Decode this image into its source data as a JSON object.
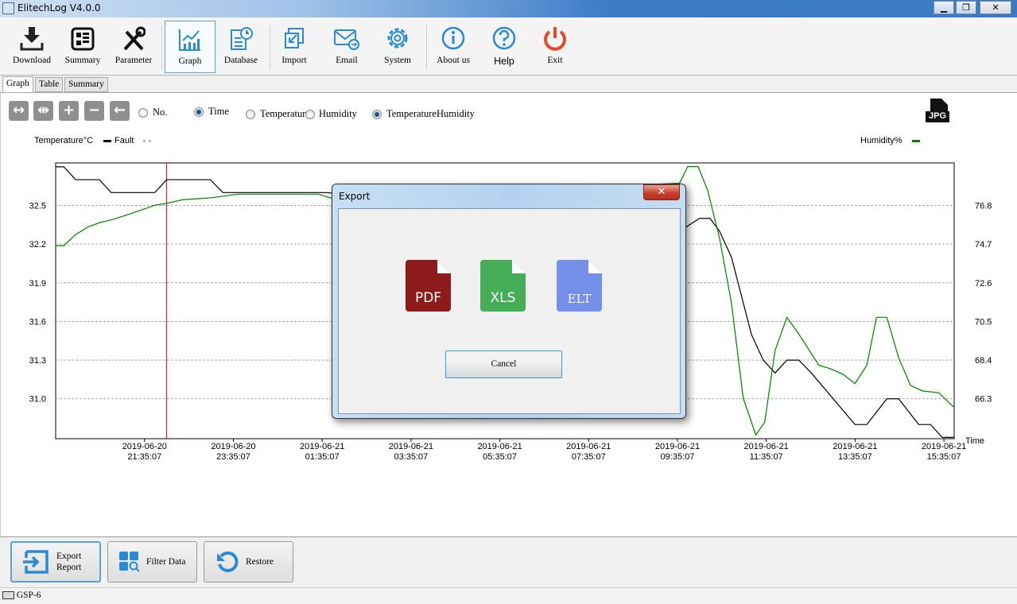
{
  "window": {
    "title": "ElitechLog V4.0.0",
    "minimize": "▁",
    "restore": "❐",
    "close": "✕"
  },
  "toolbar": {
    "items": [
      {
        "label": "Download",
        "icon": "download-icon"
      },
      {
        "label": "Summary",
        "icon": "summary-icon"
      },
      {
        "label": "Parameter",
        "icon": "tools-icon"
      },
      {
        "label": "Graph",
        "icon": "graph-icon",
        "selected": true
      },
      {
        "label": "Database",
        "icon": "database-icon"
      },
      {
        "label": "Import",
        "icon": "import-icon"
      },
      {
        "label": "Email",
        "icon": "email-icon"
      },
      {
        "label": "System",
        "icon": "gear-icon"
      },
      {
        "label": "About us",
        "icon": "info-icon"
      },
      {
        "label": "Help",
        "icon": "help-icon"
      },
      {
        "label": "Exit",
        "icon": "power-icon"
      }
    ]
  },
  "tabs": [
    {
      "label": "Graph",
      "active": true
    },
    {
      "label": "Table"
    },
    {
      "label": "Summary"
    }
  ],
  "graph_controls": {
    "buttons": [
      {
        "icon": "expand-icon",
        "glyph": "↔"
      },
      {
        "icon": "collapse-icon",
        "glyph": "⇹"
      },
      {
        "icon": "zoom-in-icon",
        "glyph": "+"
      },
      {
        "icon": "zoom-out-icon",
        "glyph": "−"
      },
      {
        "icon": "back-icon",
        "glyph": "←"
      }
    ],
    "axis_mode": [
      {
        "label": "No.",
        "selected": false
      },
      {
        "label": "Time",
        "selected": true
      }
    ],
    "series_mode": [
      {
        "label": "Temperatur",
        "selected": false
      },
      {
        "label": "Humidity",
        "selected": false
      },
      {
        "label": "TemperatureHumidity",
        "selected": true
      }
    ],
    "jpg_label": "JPG"
  },
  "legend": {
    "left_title": "Temperature°C",
    "fault_label": "Fault",
    "right_title": "Humidity%"
  },
  "colors": {
    "temperature": "#000000",
    "humidity": "#008000",
    "cursor": "#e00000",
    "accent": "#2a8ad4",
    "pdf": "#8e1b1b",
    "xls": "#46ad57",
    "elt": "#7490e8"
  },
  "chart_data": {
    "type": "line",
    "xlabel": "Time",
    "x_ticks": [
      "2019-06-20 21:35:07",
      "2019-06-20 23:35:07",
      "2019-06-21 01:35:07",
      "2019-06-21 03:35:07",
      "2019-06-21 05:35:07",
      "2019-06-21 07:35:07",
      "2019-06-21 09:35:07",
      "2019-06-21 11:35:07",
      "2019-06-21 13:35:07",
      "2019-06-21 15:35:07"
    ],
    "xlim": [
      "2019-06-20 19:35",
      "2019-06-21 15:49"
    ],
    "y_left": {
      "label": "Temperature°C",
      "ticks": [
        32.5,
        32.2,
        31.9,
        31.6,
        31.3,
        31.0
      ],
      "lim": [
        30.69,
        32.83
      ]
    },
    "y_right": {
      "label": "Humidity%",
      "ticks": [
        76.8,
        74.7,
        72.6,
        70.5,
        68.4,
        66.3
      ],
      "lim": [
        64.1,
        79.1
      ]
    },
    "grid": true,
    "cursor_time": "2019-06-20 22:05",
    "series": [
      {
        "name": "Temperature°C",
        "axis": "left",
        "points": [
          [
            "2019-06-20 19:35",
            32.8
          ],
          [
            "2019-06-20 19:46",
            32.8
          ],
          [
            "2019-06-20 20:02",
            32.7
          ],
          [
            "2019-06-20 20:34",
            32.7
          ],
          [
            "2019-06-20 20:50",
            32.6
          ],
          [
            "2019-06-20 21:49",
            32.6
          ],
          [
            "2019-06-20 22:05",
            32.7
          ],
          [
            "2019-06-20 23:04",
            32.7
          ],
          [
            "2019-06-20 23:21",
            32.6
          ],
          [
            "2019-06-21 01:40",
            32.6
          ],
          [
            "2019-06-21 05:00",
            32.5
          ],
          [
            "2019-06-21 09:38",
            32.3
          ],
          [
            "2019-06-21 10:05",
            32.4
          ],
          [
            "2019-06-21 10:19",
            32.4
          ],
          [
            "2019-06-21 10:32",
            32.3
          ],
          [
            "2019-06-21 10:48",
            32.1
          ],
          [
            "2019-06-21 11:15",
            31.5
          ],
          [
            "2019-06-21 11:31",
            31.3
          ],
          [
            "2019-06-21 11:47",
            31.2
          ],
          [
            "2019-06-21 12:03",
            31.3
          ],
          [
            "2019-06-21 12:19",
            31.3
          ],
          [
            "2019-06-21 12:36",
            31.2
          ],
          [
            "2019-06-21 13:35",
            30.8
          ],
          [
            "2019-06-21 13:51",
            30.8
          ],
          [
            "2019-06-21 14:18",
            31.0
          ],
          [
            "2019-06-21 14:34",
            31.0
          ],
          [
            "2019-06-21 15:01",
            30.8
          ],
          [
            "2019-06-21 15:17",
            30.8
          ],
          [
            "2019-06-21 15:33",
            30.7
          ],
          [
            "2019-06-21 15:49",
            30.7
          ]
        ]
      },
      {
        "name": "Humidity%",
        "axis": "right",
        "points": [
          [
            "2019-06-20 19:35",
            74.6
          ],
          [
            "2019-06-20 19:46",
            74.6
          ],
          [
            "2019-06-20 20:02",
            75.2
          ],
          [
            "2019-06-20 20:18",
            75.6
          ],
          [
            "2019-06-20 20:34",
            75.85
          ],
          [
            "2019-06-20 20:50",
            76.0
          ],
          [
            "2019-06-20 21:06",
            76.2
          ],
          [
            "2019-06-20 21:28",
            76.5
          ],
          [
            "2019-06-20 21:49",
            76.8
          ],
          [
            "2019-06-20 22:05",
            76.9
          ],
          [
            "2019-06-20 22:27",
            77.1
          ],
          [
            "2019-06-20 23:04",
            77.2
          ],
          [
            "2019-06-20 23:42",
            77.4
          ],
          [
            "2019-06-21 00:14",
            77.4
          ],
          [
            "2019-06-21 01:30",
            77.4
          ],
          [
            "2019-06-21 01:46",
            77.2
          ],
          [
            "2019-06-21 05:00",
            77.5
          ],
          [
            "2019-06-21 09:38",
            78.0
          ],
          [
            "2019-06-21 09:49",
            78.9
          ],
          [
            "2019-06-21 10:03",
            78.9
          ],
          [
            "2019-06-21 10:16",
            77.6
          ],
          [
            "2019-06-21 10:32",
            75.0
          ],
          [
            "2019-06-21 10:48",
            71.5
          ],
          [
            "2019-06-21 11:04",
            66.3
          ],
          [
            "2019-06-21 11:21",
            64.3
          ],
          [
            "2019-06-21 11:33",
            65.0
          ],
          [
            "2019-06-21 11:47",
            68.9
          ],
          [
            "2019-06-21 12:03",
            70.7
          ],
          [
            "2019-06-21 12:19",
            69.8
          ],
          [
            "2019-06-21 12:46",
            68.1
          ],
          [
            "2019-06-21 13:02",
            67.9
          ],
          [
            "2019-06-21 13:19",
            67.6
          ],
          [
            "2019-06-21 13:35",
            67.1
          ],
          [
            "2019-06-21 13:51",
            68.1
          ],
          [
            "2019-06-21 14:04",
            70.7
          ],
          [
            "2019-06-21 14:18",
            70.7
          ],
          [
            "2019-06-21 14:34",
            68.5
          ],
          [
            "2019-06-21 14:50",
            67.0
          ],
          [
            "2019-06-21 15:06",
            66.7
          ],
          [
            "2019-06-21 15:28",
            66.6
          ],
          [
            "2019-06-21 15:49",
            65.8
          ]
        ]
      }
    ]
  },
  "dialog": {
    "title": "Export",
    "close": "✕",
    "options": [
      {
        "label": "PDF"
      },
      {
        "label": "XLS"
      },
      {
        "label": "ELT"
      }
    ],
    "cancel": "Cancel"
  },
  "bottom": {
    "export": "Export\nReport",
    "filter": "Filter Data",
    "restore": "Restore"
  },
  "status": {
    "device": "GSP-6"
  }
}
